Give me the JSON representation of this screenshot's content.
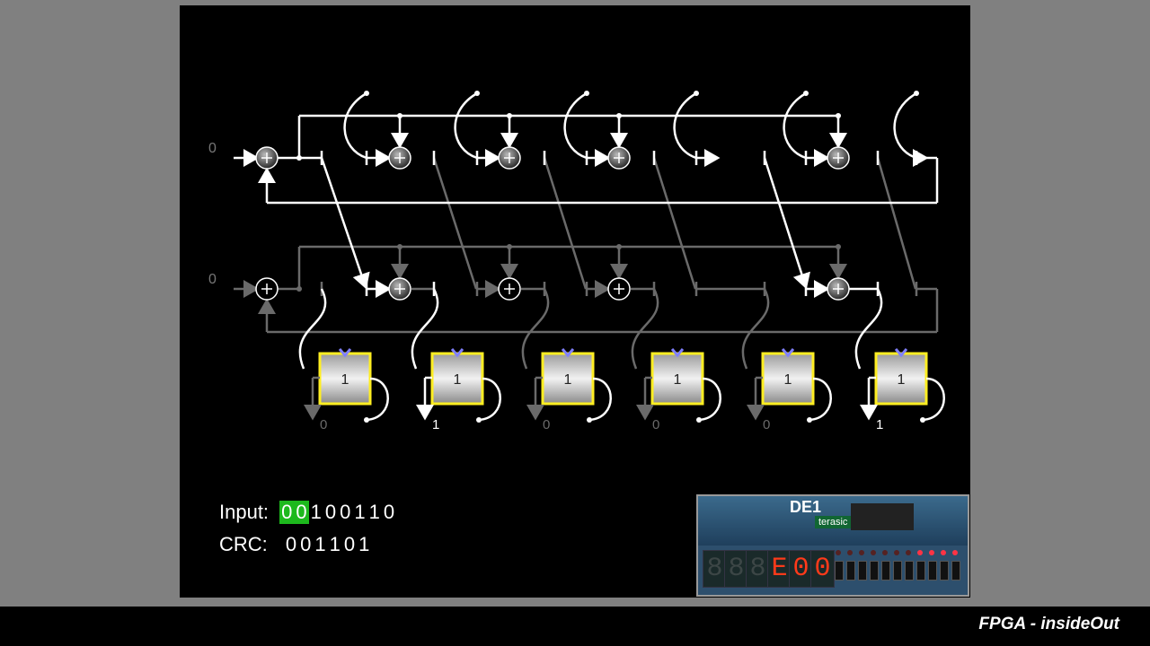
{
  "input": {
    "label": "Input:",
    "bits": [
      "0",
      "0",
      "1",
      "0",
      "0",
      "1",
      "1",
      "0"
    ],
    "highlighted_count": 2
  },
  "crc": {
    "label": "CRC:",
    "bits": [
      "0",
      "0",
      "1",
      "1",
      "0",
      "1"
    ]
  },
  "row_inputs": [
    "0",
    "0"
  ],
  "registers": [
    {
      "value": "1",
      "output": "0"
    },
    {
      "value": "1",
      "output": "1"
    },
    {
      "value": "1",
      "output": "0"
    },
    {
      "value": "1",
      "output": "0"
    },
    {
      "value": "1",
      "output": "0"
    },
    {
      "value": "1",
      "output": "1"
    }
  ],
  "board": {
    "logo": "DE1",
    "brand": "terasic",
    "display": [
      "8",
      "8",
      "8",
      "E",
      "0",
      "0"
    ]
  },
  "footer": {
    "brand": "FPGA - insideOut"
  },
  "colors": {
    "active_wire": "#ffffff",
    "inactive_wire": "#6a6a6a",
    "register_border": "#ffee22",
    "highlight": "#1db91d"
  }
}
